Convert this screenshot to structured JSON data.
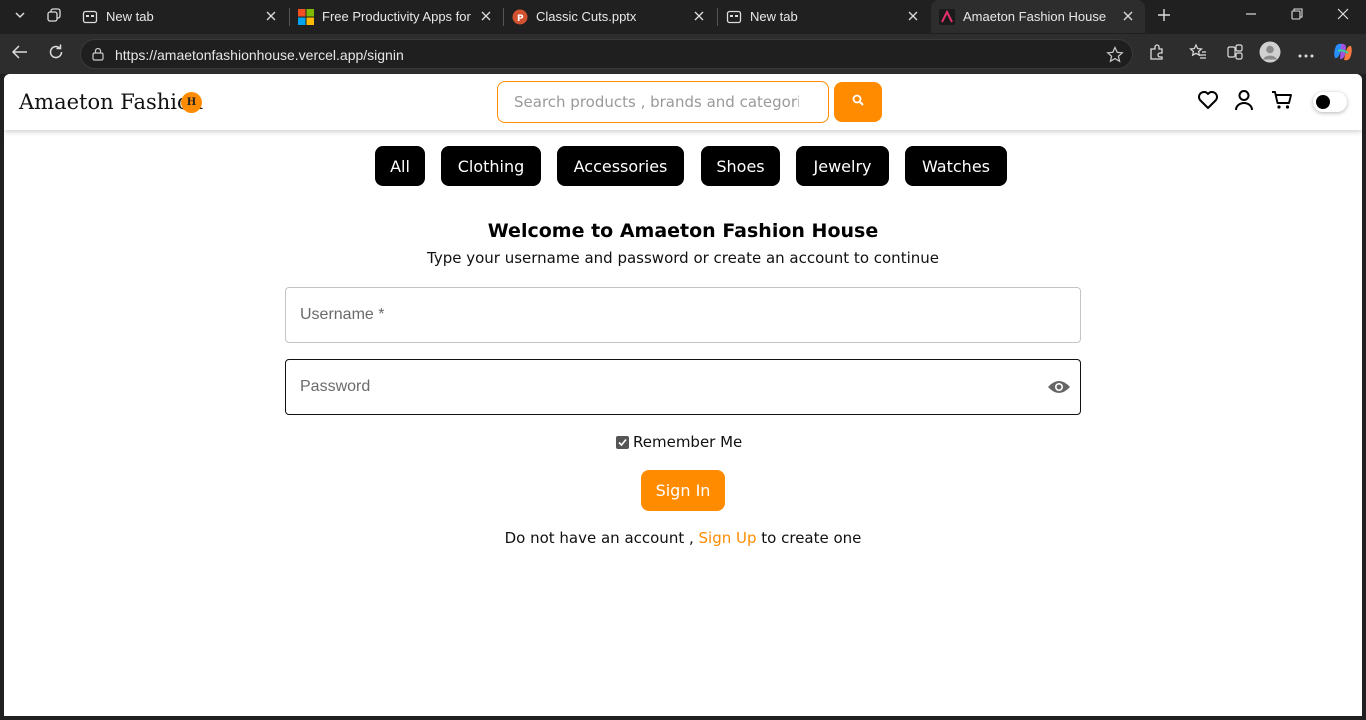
{
  "browser": {
    "tabs": [
      {
        "title": "New tab",
        "icon": "new-tab-page-icon"
      },
      {
        "title": "Free Productivity Apps for Pe",
        "icon": "microsoft-logo-icon"
      },
      {
        "title": "Classic Cuts.pptx",
        "icon": "powerpoint-icon"
      },
      {
        "title": "New tab",
        "icon": "new-tab-page-icon"
      },
      {
        "title": "Amaeton Fashion House",
        "icon": "site-favicon"
      }
    ],
    "url": "https://amaetonfashionhouse.vercel.app/signin"
  },
  "header": {
    "logo_text": "Amaeton Fashion",
    "logo_badge": "H",
    "search_placeholder": "Search products , brands and categories",
    "accent_color": "#ff8c00"
  },
  "categories": [
    "All",
    "Clothing",
    "Accessories",
    "Shoes",
    "Jewelry",
    "Watches"
  ],
  "signin": {
    "title": "Welcome to Amaeton Fashion House",
    "subtitle": "Type your username and password or create an account to continue",
    "username_placeholder": "Username *",
    "password_placeholder": "Password",
    "remember_label": "Remember Me",
    "remember_checked": true,
    "submit_label": "Sign In",
    "signup_prefix": "Do not have an account , ",
    "signup_link": "Sign Up",
    "signup_suffix": " to create one"
  }
}
